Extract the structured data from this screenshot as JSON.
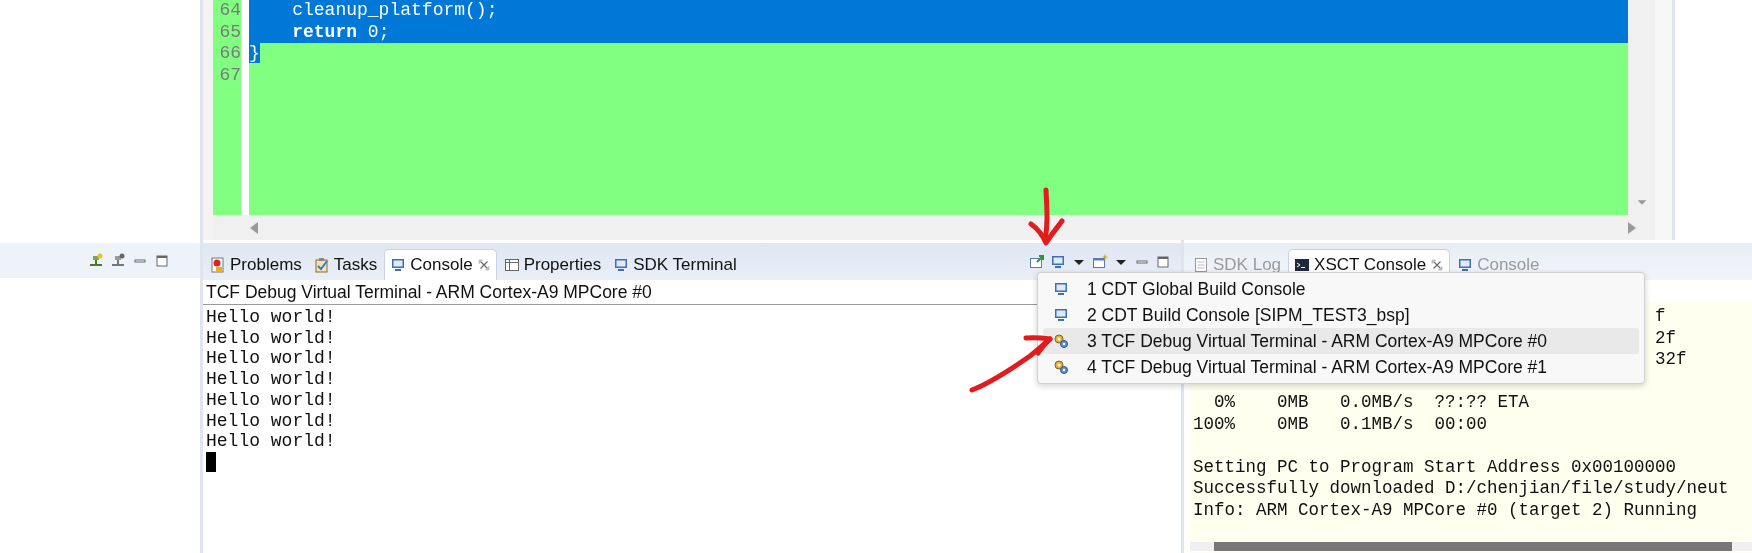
{
  "editor": {
    "lines": [
      {
        "number": "64",
        "code": "    cleanup_platform();",
        "selected": true
      },
      {
        "number": "65",
        "code": "    **return** 0;",
        "selected": true
      },
      {
        "number": "66",
        "code": "}",
        "selected": true
      },
      {
        "number": "67",
        "selected": false
      }
    ]
  },
  "console_pane": {
    "active": true,
    "tabs": [
      {
        "label": "Problems",
        "kind": "problems",
        "selected": false
      },
      {
        "label": "Tasks",
        "kind": "tasks",
        "selected": false
      },
      {
        "label": "Console",
        "kind": "console",
        "selected": true
      },
      {
        "label": "Properties",
        "kind": "properties",
        "selected": false
      },
      {
        "label": "SDK Terminal",
        "kind": "console",
        "selected": false
      }
    ],
    "title": "TCF Debug Virtual Terminal - ARM Cortex-A9 MPCore #0",
    "output": [
      "Hello world!",
      "Hello world!",
      "Hello world!",
      "Hello world!",
      "Hello world!",
      "Hello world!",
      "Hello world!"
    ]
  },
  "xsct_pane": {
    "active": false,
    "tabs": [
      {
        "label": "SDK Log",
        "kind": "log",
        "selected": false
      },
      {
        "label": "XSCT Console",
        "kind": "terminal",
        "selected": true
      },
      {
        "label": "Console",
        "kind": "console",
        "selected": false
      }
    ],
    "blocks": [
      [
        {
          "text": "f",
          "kind": "clipped"
        },
        {
          "text": "2f",
          "kind": "clipped"
        },
        {
          "text": "32f",
          "kind": "clipped"
        }
      ],
      [
        {
          "text": "  0%    0MB   0.0MB/s  ??:?? ETA",
          "kind": "full"
        },
        {
          "text": "100%    0MB   0.1MB/s  00:00",
          "kind": "full"
        }
      ],
      [
        {
          "text": "Setting PC to Program Start Address 0x00100000",
          "kind": "full"
        },
        {
          "text": "Successfully downloaded D:/chenjian/file/study/neut",
          "kind": "full"
        },
        {
          "text": "Info: ARM Cortex-A9 MPCore #0 (target 2) Running",
          "kind": "full"
        }
      ]
    ]
  },
  "console_menu": {
    "items": [
      {
        "label": "1 CDT Global Build Console",
        "kind": "build",
        "selected": false
      },
      {
        "label": "2 CDT Build Console [SIPM_TEST3_bsp]",
        "kind": "build",
        "selected": false
      },
      {
        "label": "3 TCF Debug Virtual Terminal - ARM Cortex-A9 MPCore #0",
        "kind": "debug",
        "selected": true
      },
      {
        "label": "4 TCF Debug Virtual Terminal - ARM Cortex-A9 MPCore #1",
        "kind": "debug",
        "selected": false
      }
    ]
  }
}
